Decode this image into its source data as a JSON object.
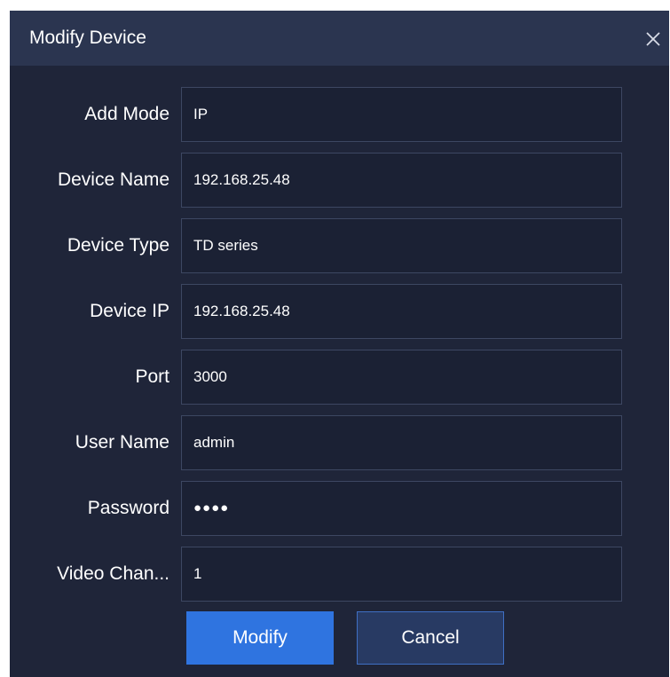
{
  "dialog": {
    "title": "Modify Device",
    "close_icon": "close-icon",
    "colors": {
      "background": "#1f2539",
      "titlebar": "#2b3550",
      "field_background": "#1b2134",
      "field_border": "#3d4762",
      "primary_button": "#2f74e0",
      "secondary_button": "#283a63",
      "text": "#ffffff"
    }
  },
  "form": {
    "fields": [
      {
        "label": "Add Mode",
        "value": "IP"
      },
      {
        "label": "Device Name",
        "value": "192.168.25.48"
      },
      {
        "label": "Device Type",
        "value": "TD series"
      },
      {
        "label": "Device IP",
        "value": "192.168.25.48"
      },
      {
        "label": "Port",
        "value": "3000"
      },
      {
        "label": "User Name",
        "value": "admin"
      },
      {
        "label": "Password",
        "value": "●●●●"
      },
      {
        "label": "Video Chan...",
        "value": "1"
      }
    ]
  },
  "buttons": {
    "modify_label": "Modify",
    "cancel_label": "Cancel"
  }
}
